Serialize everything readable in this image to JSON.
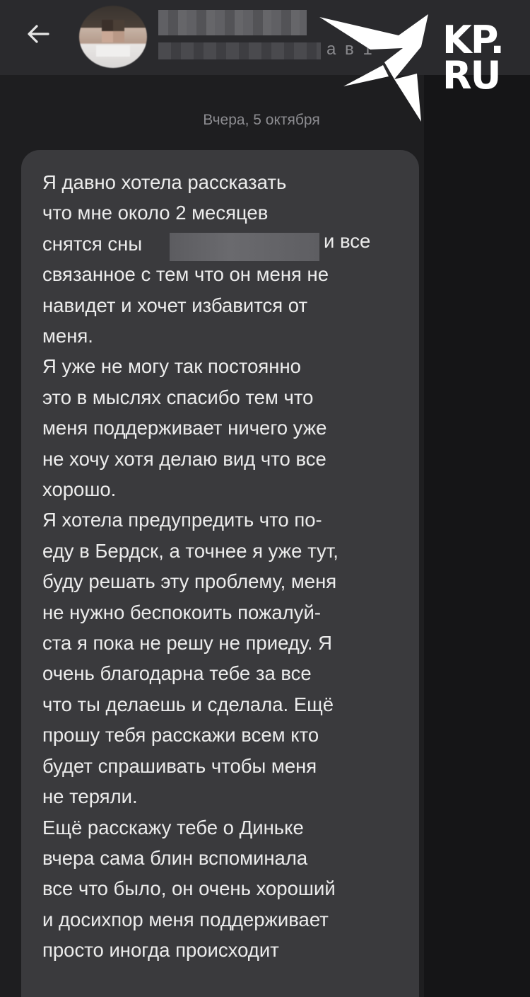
{
  "header": {
    "back_label": "",
    "contact_status_tail": "а в 1"
  },
  "watermark": {
    "brand": "KP.RU",
    "line1": "KP.",
    "line2": "RU"
  },
  "chat": {
    "date_separator": "Вчера, 5 октября",
    "message": {
      "text_before": "Я давно хотела рассказать\nчто мне около 2 месяцев\nснятся сны",
      "redacted_tail": "и все",
      "text_after": "связанное с тем что он меня не\nнавидет и хочет избавится от\nменя.\nЯ уже не могу так постоянно\nэто в мыслях спасибо тем что\nменя поддерживает ничего уже\nне хочу хотя делаю вид что все\nхорошо.\nЯ хотела предупредить что по-\nеду в Бердск, а точнее я уже тут,\nбуду решать эту проблему, меня\nне нужно беспокоить пожалуй-\nста я пока не решу не приеду. Я\nочень благодарна тебе за все\nчто ты делаешь и сделала. Ещё\nпрошу тебя расскажи всем кто\nбудет спрашивать чтобы меня\nне теряли.\nЕщё расскажу тебе о Диньке\nвчера сама блин вспоминала\nвсе что было, он очень хороший\nи досихпор меня поддерживает\nпросто иногда происходит"
    }
  },
  "colors": {
    "background": "#1e1e20",
    "topbar": "#2a2a2d",
    "bubble": "#3a3a3d",
    "text": "#ececec",
    "date_text": "#8c8c90"
  }
}
